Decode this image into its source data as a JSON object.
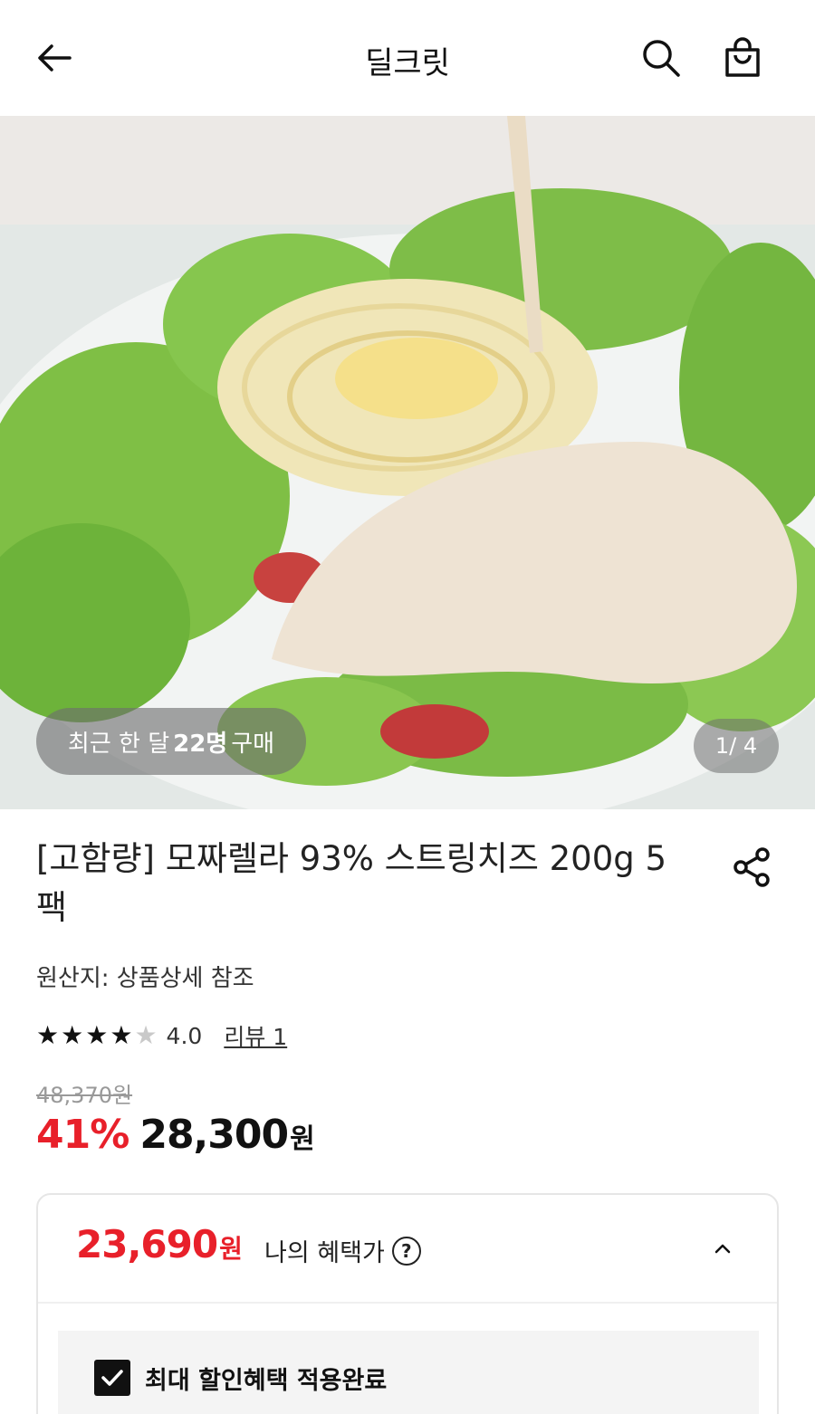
{
  "header": {
    "title": "딜크릿",
    "back_icon": "arrow-left-icon",
    "search_icon": "search-icon",
    "cart_icon": "shopping-bag-icon"
  },
  "hero": {
    "purchase_prefix": "최근 한 달",
    "purchase_count": "22명",
    "purchase_suffix": "구매",
    "page_counter": "1/ 4"
  },
  "product": {
    "title": "[고함량] 모짜렐라 93% 스트링치즈 200g 5팩",
    "origin": "원산지: 상품상세 참조",
    "rating": 4.0,
    "rating_text": "4.0",
    "review_link": "리뷰 1",
    "original_price": "48,370원",
    "discount": "41%",
    "sale_price": "28,300",
    "currency": "원"
  },
  "benefit": {
    "amount": "23,690",
    "currency": "원",
    "label": "나의 혜택가",
    "help": "?",
    "check_label": "최대 할인혜택 적용완료"
  },
  "colors": {
    "accent_red": "#e8202a",
    "text": "#111111",
    "muted": "#999999"
  }
}
